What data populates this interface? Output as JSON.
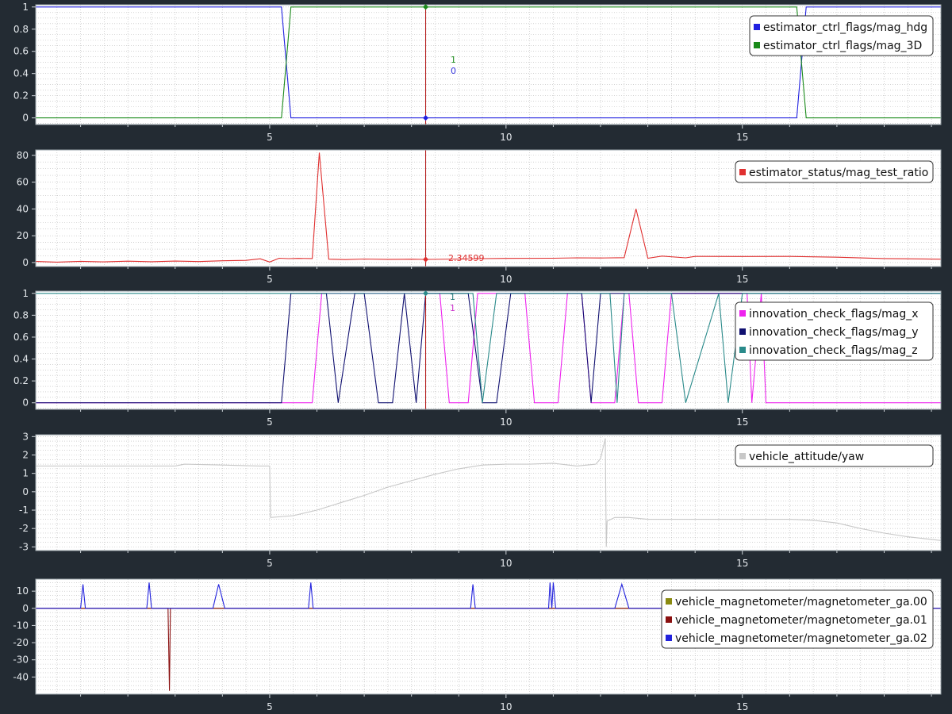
{
  "cursor": {
    "x": 8.3,
    "labels": [
      {
        "text": "1",
        "color": "#1a8a1a"
      },
      {
        "text": "0",
        "color": "#3333dd"
      },
      {
        "text": "2.34599",
        "color": "#e03030"
      },
      {
        "text": "1",
        "color": "#2a7a7a"
      },
      {
        "text": "1",
        "color": "#cc33cc"
      }
    ]
  },
  "colors": {
    "background": "#232b33",
    "plot_area": "#ffffff",
    "cursor_line": "#b01010",
    "legend_bg": "#ffffff"
  },
  "chart_data": [
    {
      "type": "line",
      "xlim": [
        0.05,
        19.2
      ],
      "ylim": [
        -0.06,
        1.02
      ],
      "xticks": [
        5,
        10,
        15
      ],
      "yticks": [
        "0",
        "0.2",
        "0.4",
        "0.6",
        "0.8",
        "1"
      ],
      "ytick_values": [
        0,
        0.2,
        0.4,
        0.6,
        0.8,
        1
      ],
      "grid": true,
      "legend_position": "top-right",
      "series": [
        {
          "name": "estimator_ctrl_flags/mag_hdg",
          "color": "#2020e0",
          "x": [
            0.05,
            5.25,
            5.45,
            16.15,
            16.35,
            19.2
          ],
          "y": [
            1,
            1,
            0,
            0,
            1,
            1
          ]
        },
        {
          "name": "estimator_ctrl_flags/mag_3D",
          "color": "#1a8a1a",
          "x": [
            0.05,
            5.25,
            5.45,
            16.15,
            16.35,
            19.2
          ],
          "y": [
            0,
            0,
            1,
            1,
            0,
            0
          ]
        }
      ]
    },
    {
      "type": "line",
      "xlim": [
        0.05,
        19.2
      ],
      "ylim": [
        -3,
        84
      ],
      "xticks": [
        5,
        10,
        15
      ],
      "yticks": [
        "0",
        "20",
        "40",
        "60",
        "80"
      ],
      "ytick_values": [
        0,
        20,
        40,
        60,
        80
      ],
      "grid": true,
      "legend_position": "top-right",
      "series": [
        {
          "name": "estimator_status/mag_test_ratio",
          "color": "#e03030",
          "x": [
            0.05,
            0.5,
            1,
            1.5,
            2,
            2.5,
            3,
            3.5,
            4,
            4.5,
            4.8,
            5.0,
            5.2,
            5.4,
            5.6,
            5.9,
            6.05,
            6.25,
            6.6,
            7,
            7.5,
            8,
            8.3,
            9,
            9.5,
            10,
            11,
            11.5,
            12,
            12.5,
            12.75,
            13.0,
            13.3,
            13.8,
            14,
            15,
            16,
            17,
            18,
            19.2
          ],
          "y": [
            0.8,
            0.3,
            0.9,
            0.5,
            1.0,
            0.6,
            1.1,
            0.7,
            1.3,
            1.6,
            2.8,
            0.4,
            3.2,
            2.9,
            3.1,
            3.0,
            82,
            2.5,
            2.2,
            2.6,
            2.4,
            2.5,
            2.35,
            2.6,
            2.9,
            3.1,
            3.2,
            3.5,
            3.4,
            3.6,
            40,
            3.2,
            4.8,
            3.5,
            4.6,
            4.5,
            4.6,
            4.0,
            3.0,
            2.5
          ]
        }
      ]
    },
    {
      "type": "line",
      "xlim": [
        0.05,
        19.2
      ],
      "ylim": [
        -0.06,
        1.02
      ],
      "xticks": [
        5,
        10,
        15
      ],
      "yticks": [
        "0",
        "0.2",
        "0.4",
        "0.6",
        "0.8",
        "1"
      ],
      "ytick_values": [
        0,
        0.2,
        0.4,
        0.6,
        0.8,
        1
      ],
      "grid": true,
      "legend_position": "top-right",
      "series": [
        {
          "name": "innovation_check_flags/mag_x",
          "color": "#ee22ee",
          "x": [
            0.05,
            5.9,
            6.1,
            8.6,
            8.8,
            9.2,
            9.4,
            10.4,
            10.6,
            11.1,
            11.3,
            11.6,
            11.8,
            12.3,
            12.5,
            12.6,
            12.8,
            13.3,
            13.5,
            15.1,
            15.2,
            15.4,
            15.5,
            19.2
          ],
          "y": [
            0,
            0,
            1,
            1,
            0,
            0,
            1,
            1,
            0,
            0,
            1,
            1,
            0,
            0,
            1,
            1,
            0,
            0,
            1,
            1,
            0,
            1,
            0,
            0
          ]
        },
        {
          "name": "innovation_check_flags/mag_y",
          "color": "#101070",
          "x": [
            0.05,
            5.25,
            5.45,
            6.2,
            6.45,
            6.8,
            7,
            7.3,
            7.6,
            7.85,
            8.1,
            8.3,
            8.5,
            9.2,
            9.5,
            9.8,
            10.1,
            10.6,
            10.8,
            11.1,
            11.3,
            11.6,
            11.8,
            12.0,
            12.1,
            12.3,
            19.2
          ],
          "y": [
            0,
            0,
            1,
            1,
            0,
            1,
            1,
            0,
            0,
            1,
            0,
            1,
            1,
            1,
            0,
            0,
            1,
            1,
            1,
            1,
            1,
            1,
            0,
            1,
            1,
            1,
            1
          ]
        },
        {
          "name": "innovation_check_flags/mag_z",
          "color": "#2a8a8a",
          "x": [
            0.05,
            9.0,
            9.3,
            9.5,
            9.8,
            12.2,
            12.35,
            12.5,
            13.3,
            13.5,
            13.8,
            14.5,
            14.7,
            15.0,
            19.2
          ],
          "y": [
            1,
            1,
            1,
            0,
            1,
            1,
            0,
            1,
            1,
            1,
            0,
            1,
            0,
            1,
            1
          ]
        }
      ]
    },
    {
      "type": "line",
      "xlim": [
        0.05,
        19.2
      ],
      "ylim": [
        -3.2,
        3.1
      ],
      "xticks": [
        5,
        10,
        15
      ],
      "yticks": [
        "-3",
        "-2",
        "-1",
        "0",
        "1",
        "2",
        "3"
      ],
      "ytick_values": [
        -3,
        -2,
        -1,
        0,
        1,
        2,
        3
      ],
      "grid": true,
      "legend_position": "top-right",
      "series": [
        {
          "name": "vehicle_attitude/yaw",
          "color": "#c8c8c8",
          "x": [
            0.05,
            3,
            3.2,
            4,
            4.8,
            5.0,
            5.02,
            5.5,
            6,
            6.5,
            7,
            7.5,
            8,
            8.5,
            9,
            9.5,
            10,
            10.5,
            11,
            11.5,
            11.9,
            12.0,
            12.1,
            12.12,
            12.14,
            12.3,
            12.6,
            13,
            14,
            15,
            16,
            16.5,
            17,
            17.5,
            18,
            18.5,
            19.2
          ],
          "y": [
            1.4,
            1.4,
            1.5,
            1.45,
            1.4,
            1.4,
            -1.4,
            -1.3,
            -1.0,
            -0.6,
            -0.2,
            0.25,
            0.6,
            0.95,
            1.25,
            1.45,
            1.5,
            1.5,
            1.55,
            1.4,
            1.5,
            1.8,
            2.9,
            -3.0,
            -1.6,
            -1.4,
            -1.4,
            -1.5,
            -1.5,
            -1.5,
            -1.5,
            -1.55,
            -1.7,
            -2.0,
            -2.25,
            -2.45,
            -2.65
          ]
        }
      ]
    },
    {
      "type": "line",
      "xlim": [
        0.05,
        19.2
      ],
      "ylim": [
        -50,
        17
      ],
      "xticks": [
        5,
        10,
        15
      ],
      "yticks": [
        "-40",
        "-30",
        "-20",
        "-10",
        "0",
        "10"
      ],
      "ytick_values": [
        -40,
        -30,
        -20,
        -10,
        0,
        10
      ],
      "grid": true,
      "legend_position": "top-right",
      "series": [
        {
          "name": "vehicle_magnetometer/magnetometer_ga.00",
          "color": "#8a8a10",
          "x": [
            0.05,
            19.2
          ],
          "y": [
            0,
            0
          ]
        },
        {
          "name": "vehicle_magnetometer/magnetometer_ga.01",
          "color": "#8a1010",
          "x": [
            0.05,
            2.85,
            2.88,
            2.9,
            19.2
          ],
          "y": [
            0,
            0,
            -48,
            0,
            0
          ]
        },
        {
          "name": "vehicle_magnetometer/magnetometer_ga.02",
          "color": "#2222dd",
          "x": [
            0.05,
            1.0,
            1.05,
            1.1,
            2.4,
            2.45,
            2.5,
            3.8,
            3.92,
            4.05,
            5.82,
            5.87,
            5.92,
            9.25,
            9.3,
            9.35,
            10.9,
            10.93,
            10.97,
            11.0,
            11.05,
            12.3,
            12.45,
            12.6,
            19.2
          ],
          "y": [
            0,
            0,
            14,
            0,
            0,
            15,
            0,
            0,
            14,
            0,
            0,
            15,
            0,
            0,
            14,
            0,
            0,
            15,
            0,
            15,
            0,
            0,
            14,
            0,
            0
          ]
        }
      ]
    }
  ]
}
